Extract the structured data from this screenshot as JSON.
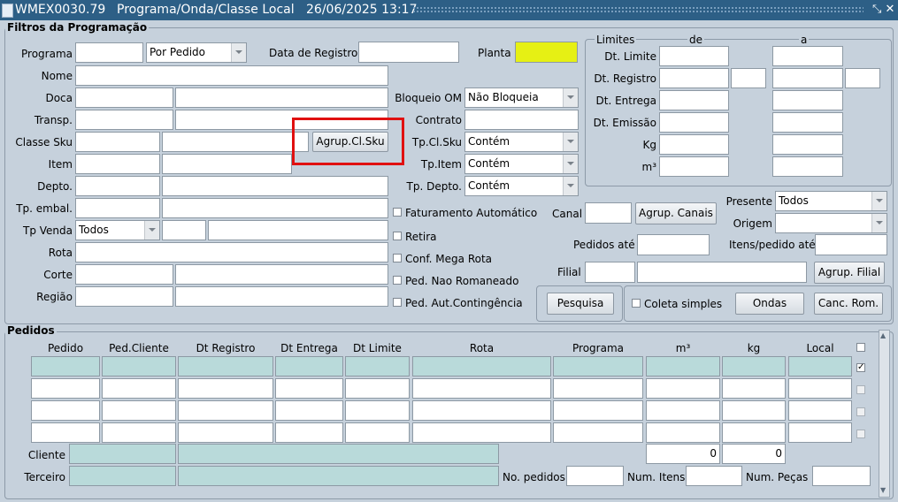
{
  "window": {
    "title": "WMEX0030.79",
    "subtitle": "Programa/Onda/Classe Local",
    "datetime": "26/06/2025 13:17",
    "controls": "⤡ ✕"
  },
  "filtros": {
    "title": "Filtros da Programação",
    "programa_label": "Programa",
    "programa_tipo": "Por Pedido",
    "data_registro_label": "Data de Registro",
    "planta_label": "Planta",
    "nome_label": "Nome",
    "doca_label": "Doca",
    "transp_label": "Transp.",
    "classe_sku_label": "Classe Sku",
    "agrup_cl_sku": "Agrup.Cl.Sku",
    "item_label": "Item",
    "depto_label": "Depto.",
    "tp_embal_label": "Tp. embal.",
    "tp_venda_label": "Tp Venda",
    "tp_venda_value": "Todos",
    "rota_label": "Rota",
    "corte_label": "Corte",
    "regiao_label": "Região",
    "bloqueio_label": "Bloqueio OM",
    "bloqueio_value": "Não Bloqueia",
    "contrato_label": "Contrato",
    "tp_cl_sku_label": "Tp.Cl.Sku",
    "tp_cl_sku_value": "Contém",
    "tp_item_label": "Tp.Item",
    "tp_item_value": "Contém",
    "tp_depto_label": "Tp. Depto.",
    "tp_depto_value": "Contém",
    "faturamento_auto": "Faturamento Automático",
    "retira": "Retira",
    "conf_mega_rota": "Conf. Mega Rota",
    "ped_nao_romaneado": "Ped. Nao Romaneado",
    "ped_aut_contingencia": "Ped. Aut.Contingência",
    "canal_label": "Canal",
    "agrup_canais": "Agrup. Canais",
    "presente_label": "Presente",
    "presente_value": "Todos",
    "origem_label": "Origem",
    "pedidos_ate_label": "Pedidos até",
    "itens_pedido_ate_label": "Itens/pedido até",
    "filial_label": "Filial",
    "agrup_filial": "Agrup. Filial",
    "pesquisa": "Pesquisa",
    "coleta_simples": "Coleta simples",
    "ondas": "Ondas",
    "canc_rom": "Canc. Rom.",
    "limites": {
      "title": "Limites",
      "de": "de",
      "a": "a",
      "dt_limite": "Dt. Limite",
      "dt_registro": "Dt. Registro",
      "dt_entrega": "Dt. Entrega",
      "dt_emissao": "Dt. Emissão",
      "kg": "Kg",
      "m3": "m³"
    }
  },
  "pedidos": {
    "title": "Pedidos",
    "columns": [
      "Pedido",
      "Ped.Cliente",
      "Dt Registro",
      "Dt Entrega",
      "Dt Limite",
      "Rota",
      "Programa",
      "m³",
      "kg",
      "Local"
    ],
    "rows_checked": [
      false,
      true,
      false,
      false,
      false
    ],
    "cliente_label": "Cliente",
    "terceiro_label": "Terceiro",
    "total_m3": "0",
    "total_kg": "0",
    "no_pedidos_label": "No. pedidos",
    "num_itens_label": "Num. Itens",
    "num_pecas_label": "Num. Peças"
  },
  "colors": {
    "titlebar": "#2d5f86",
    "background": "#c6d1dc",
    "planta_field": "#e6f014",
    "record_highlight": "#b9dada",
    "annotation": "#e01010"
  }
}
